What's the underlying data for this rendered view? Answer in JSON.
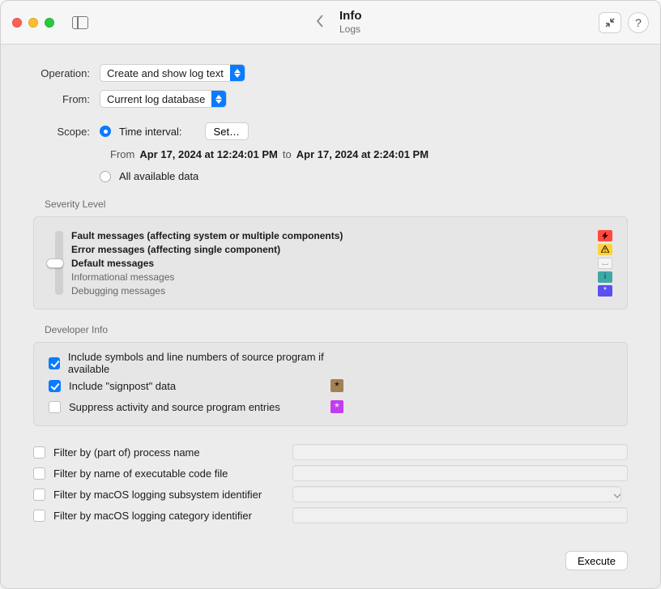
{
  "header": {
    "title": "Info",
    "subtitle": "Logs"
  },
  "form": {
    "operation_label": "Operation:",
    "operation_value": "Create and show log text",
    "from_label": "From:",
    "from_value": "Current log database",
    "scope_label": "Scope:",
    "scope_time_interval_label": "Time interval:",
    "scope_set_button": "Set…",
    "time_from_prefix": "From",
    "time_from_value": "Apr 17, 2024 at 12:24:01 PM",
    "time_to_prefix": "to",
    "time_to_value": "Apr 17, 2024 at 2:24:01 PM",
    "scope_all_label": "All available data"
  },
  "severity": {
    "section_label": "Severity Level",
    "levels": [
      "Fault messages (affecting system or multiple components)",
      "Error messages (affecting single component)",
      "Default messages",
      "Informational messages",
      "Debugging messages"
    ]
  },
  "developer": {
    "section_label": "Developer Info",
    "include_symbols": "Include symbols and line numbers of source program if available",
    "include_signpost": "Include \"signpost\" data",
    "suppress_activity": "Suppress activity and source program entries"
  },
  "filters": {
    "by_process": "Filter by (part of) process name",
    "by_executable": "Filter by name of executable code file",
    "by_subsystem": "Filter by macOS logging subsystem identifier",
    "by_category": "Filter by macOS logging category identifier"
  },
  "footer": {
    "execute": "Execute"
  },
  "icons": {
    "compress": "compress-icon",
    "help": "help-icon",
    "back": "chevron-left-icon",
    "sidebar": "sidebar-icon"
  }
}
